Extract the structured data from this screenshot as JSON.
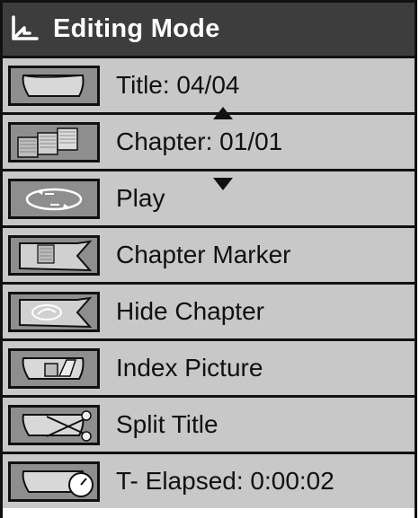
{
  "header": {
    "title": "Editing Mode",
    "icon": "editing-mode-icon"
  },
  "items": [
    {
      "label": "Title: 04/04",
      "icon": "title-folder-icon"
    },
    {
      "label": "Chapter: 01/01",
      "icon": "chapter-frames-icon"
    },
    {
      "label": "Play",
      "icon": "play-icon"
    },
    {
      "label": "Chapter Marker",
      "icon": "chapter-marker-icon"
    },
    {
      "label": "Hide Chapter",
      "icon": "hide-chapter-icon"
    },
    {
      "label": "Index Picture",
      "icon": "index-picture-icon"
    },
    {
      "label": "Split Title",
      "icon": "split-title-icon"
    },
    {
      "label": "T- Elapsed: 0:00:02",
      "icon": "elapsed-time-icon"
    }
  ],
  "colors": {
    "header_bg": "#3d3d3d",
    "row_bg": "#c8c8c8",
    "icon_bg": "#8e8e8e",
    "border": "#111111"
  }
}
